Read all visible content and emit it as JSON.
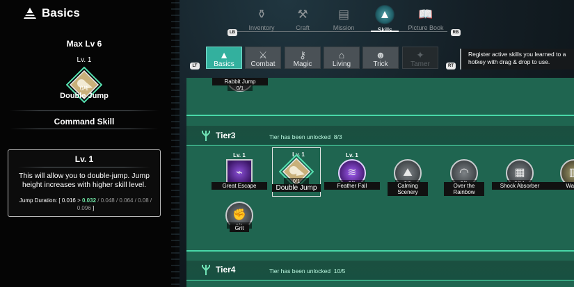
{
  "left_panel": {
    "title": "Basics",
    "max_level": "Max Lv 6",
    "selected": {
      "level": "Lv. 1",
      "progress": "0/1",
      "name": "Double Jump"
    },
    "section_title": "Command Skill",
    "description": {
      "level": "Lv. 1",
      "text": "This will allow you to double-jump. Jump height increases with higher skill level.",
      "stat_label": "Jump Duration:",
      "stat_open": "[",
      "stat_current": "0.016",
      "stat_arrow": ">",
      "stat_next": "0.032",
      "stat_rest": "/ 0.048 / 0.064 / 0.08 / 0.096",
      "stat_close": "]"
    }
  },
  "top_tabs": [
    {
      "label": "Inventory",
      "icon": "inventory-bottle-icon",
      "glyph": "⚱"
    },
    {
      "label": "Craft",
      "icon": "hammer-icon",
      "glyph": "⚒"
    },
    {
      "label": "Mission",
      "icon": "mission-list-icon",
      "glyph": "▤"
    },
    {
      "label": "Skills",
      "icon": "skills-triangle-icon",
      "glyph": "▲"
    },
    {
      "label": "Picture Book",
      "icon": "book-icon",
      "glyph": "📖"
    }
  ],
  "active_top_tab": "Skills",
  "button_badges": {
    "lb": "LB",
    "rb": "RB",
    "lt": "LT",
    "rt": "RT"
  },
  "categories": [
    {
      "label": "Basics",
      "icon": "basics-triangle-icon",
      "glyph": "▲",
      "state": "active"
    },
    {
      "label": "Combat",
      "icon": "sword-icon",
      "glyph": "⚔",
      "state": "normal"
    },
    {
      "label": "Magic",
      "icon": "magic-wand-icon",
      "glyph": "⚷",
      "state": "normal"
    },
    {
      "label": "Living",
      "icon": "house-icon",
      "glyph": "⌂",
      "state": "normal"
    },
    {
      "label": "Trick",
      "icon": "pumpkin-icon",
      "glyph": "☻",
      "state": "normal"
    },
    {
      "label": "Tamer",
      "icon": "tamer-icon",
      "glyph": "✦",
      "state": "locked"
    }
  ],
  "hint": "Register active skills you learned to a hotkey with drag & drop to use.",
  "tier2_partial": {
    "name": "Rabbit Jump",
    "progress": "0/1"
  },
  "tiers": [
    {
      "name": "Tier3",
      "status": "Tier has been unlocked",
      "count": "8/3"
    },
    {
      "name": "Tier4",
      "status": "Tier has been unlocked",
      "count": "10/5"
    }
  ],
  "tier3_skills": [
    {
      "name": "Great Escape",
      "level": "Lv. 1",
      "progress": "",
      "icon": "great-escape-icon"
    },
    {
      "name": "Double Jump",
      "level": "Lv. 1",
      "progress": "0/1",
      "icon": "double-jump-icon"
    },
    {
      "name": "Feather Fall",
      "level": "Lv. 1",
      "progress": "0/1",
      "icon": "feather-fall-icon"
    },
    {
      "name": "Calming Scenery",
      "level": "",
      "progress": "0/1",
      "icon": "calming-scenery-icon"
    },
    {
      "name": "Over the Rainbow",
      "level": "",
      "progress": "0/1",
      "icon": "over-the-rainbow-icon"
    },
    {
      "name": "Shock Absorber",
      "level": "",
      "progress": "0/1A",
      "icon": "shock-absorber-icon"
    },
    {
      "name": "Wall C",
      "level": "",
      "progress": "",
      "icon": "wall-climb-icon"
    },
    {
      "name": "Grit",
      "level": "",
      "progress": "0/1",
      "icon": "grit-icon"
    }
  ]
}
